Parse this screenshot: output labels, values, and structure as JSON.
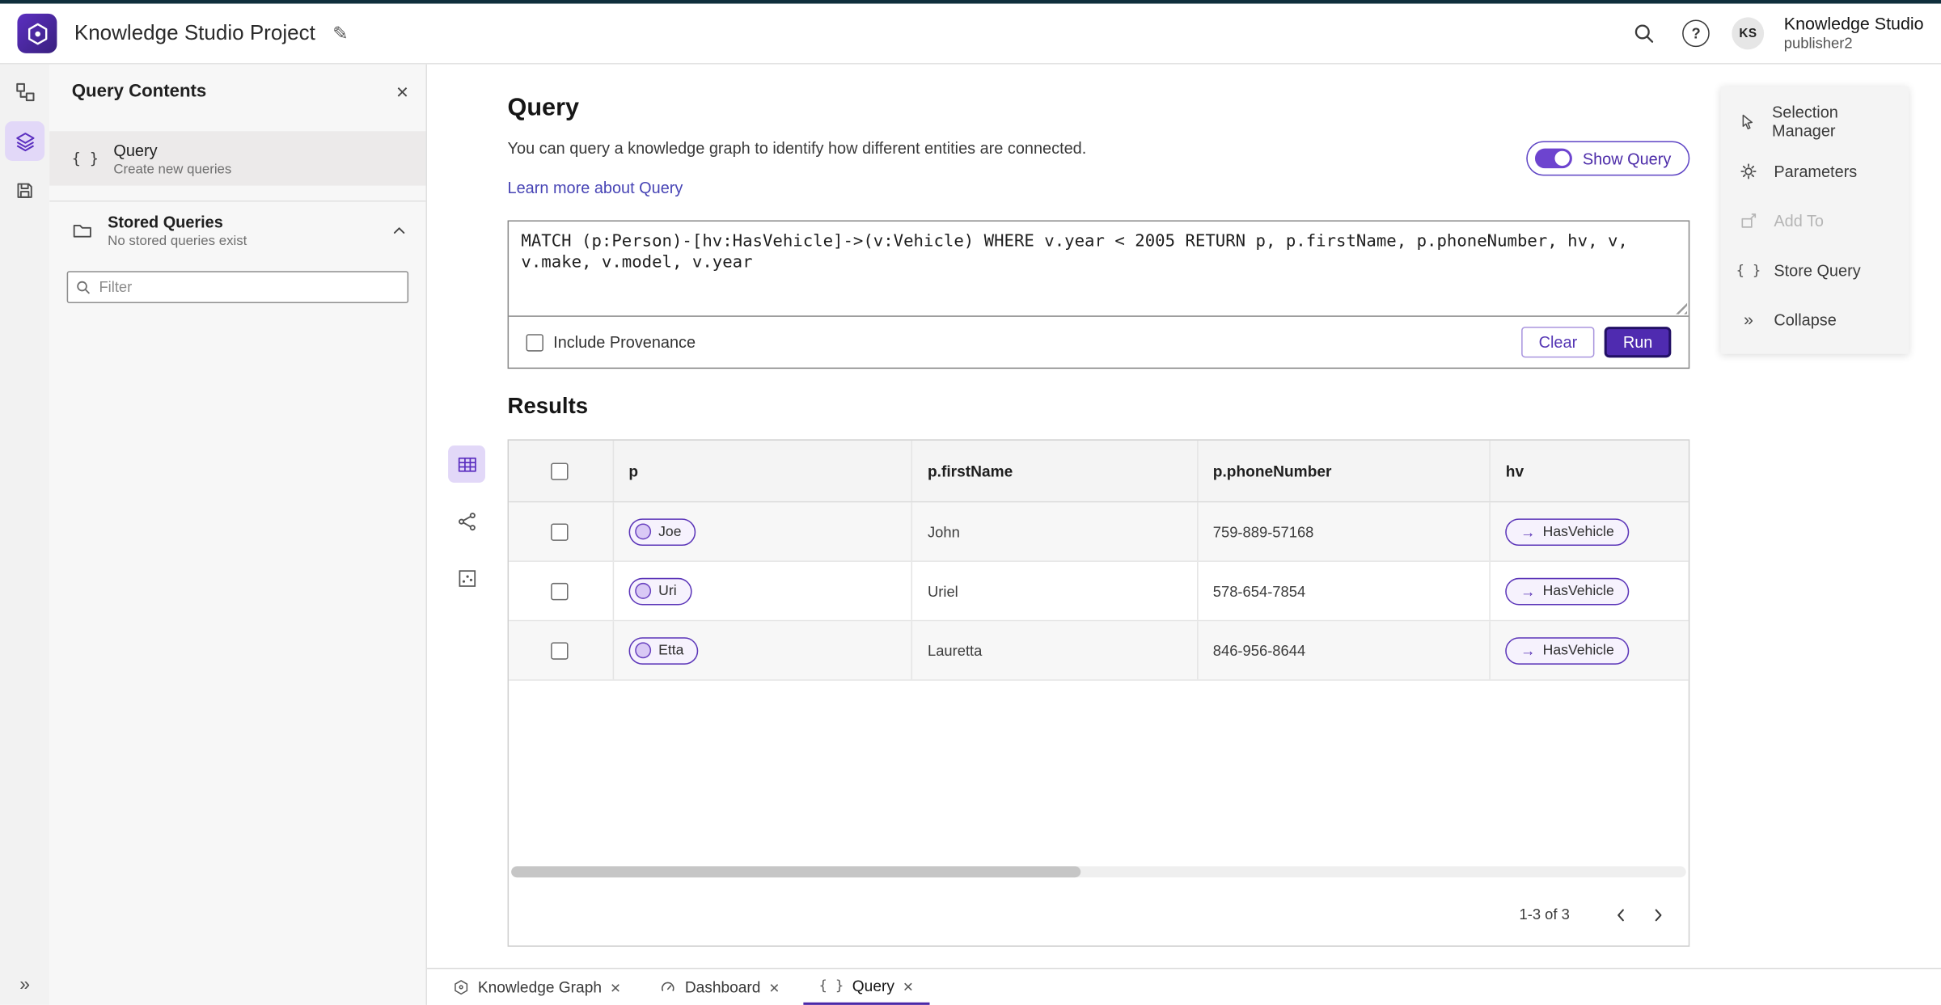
{
  "glyphs": {
    "edit": "✎",
    "close": "×",
    "braces": "{ }",
    "chevrons": "»",
    "arrow_right": "→",
    "question": "?"
  },
  "colors": {
    "accent": "#4f2bb0",
    "accent_light": "#e2d8f8",
    "link": "#4744b5",
    "toggle": "#6d44cf"
  },
  "header": {
    "title": "Knowledge Studio Project",
    "avatar_initials": "KS",
    "user_name": "Knowledge Studio",
    "user_role": "publisher2"
  },
  "left_panel": {
    "title": "Query Contents",
    "query_item": {
      "label": "Query",
      "sublabel": "Create new queries"
    },
    "stored": {
      "label": "Stored Queries",
      "sublabel": "No stored queries exist"
    },
    "filter_placeholder": "Filter"
  },
  "query": {
    "title": "Query",
    "description": "You can query a knowledge graph to identify how different entities are connected.",
    "learn_more": "Learn more about Query",
    "show_query": "Show Query",
    "text": "MATCH (p:Person)-[hv:HasVehicle]->(v:Vehicle) WHERE v.year < 2005 RETURN p, p.firstName, p.phoneNumber, hv, v, v.make, v.model, v.year",
    "include_provenance": "Include Provenance",
    "clear": "Clear",
    "run": "Run"
  },
  "results": {
    "title": "Results",
    "columns": [
      "p",
      "p.firstName",
      "p.phoneNumber",
      "hv"
    ],
    "rows": [
      {
        "p": "Joe",
        "firstName": "John",
        "phone": "759-889-57168",
        "hv": "HasVehicle"
      },
      {
        "p": "Uri",
        "firstName": "Uriel",
        "phone": "578-654-7854",
        "hv": "HasVehicle"
      },
      {
        "p": "Etta",
        "firstName": "Lauretta",
        "phone": "846-956-8644",
        "hv": "HasVehicle"
      }
    ],
    "pagination": "1-3 of 3"
  },
  "menu": {
    "items": [
      {
        "label": "Selection Manager",
        "disabled": false
      },
      {
        "label": "Parameters",
        "disabled": false
      },
      {
        "label": "Add To",
        "disabled": true
      },
      {
        "label": "Store Query",
        "disabled": false
      },
      {
        "label": "Collapse",
        "disabled": false
      }
    ]
  },
  "tabs": [
    {
      "label": "Knowledge Graph"
    },
    {
      "label": "Dashboard"
    },
    {
      "label": "Query",
      "active": true
    }
  ]
}
